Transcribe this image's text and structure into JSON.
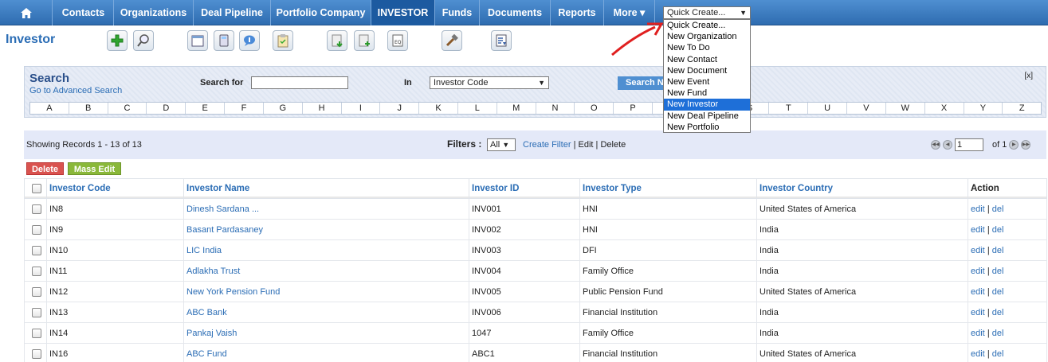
{
  "nav": {
    "home_icon": "home-icon",
    "items": [
      "Contacts",
      "Organizations",
      "Deal Pipeline",
      "Portfolio Company",
      "INVESTOR",
      "Funds",
      "Documents",
      "Reports",
      "More"
    ],
    "active": "INVESTOR",
    "more_arrow": "▾"
  },
  "quick_create": {
    "selected": "Quick Create...",
    "options": [
      "Quick Create...",
      "New Organization",
      "New To Do",
      "New Contact",
      "New Document",
      "New Event",
      "New Fund",
      "New Investor",
      "New Deal Pipeline",
      "New Portfolio"
    ],
    "highlighted": "New Investor"
  },
  "page_title": "Investor",
  "toolbar_icons": [
    "add-icon",
    "search-icon",
    "calendar-icon",
    "calculator-icon",
    "chat-icon",
    "clipboard-icon",
    "import-icon",
    "export-icon",
    "find-duplicates-icon",
    "settings-tools-icon",
    "report-icon"
  ],
  "search": {
    "title": "Search",
    "advanced_link": "Go to Advanced Search",
    "for_label": "Search for",
    "input_value": "",
    "in_label": "In",
    "in_value": "Investor Code",
    "button_label": "Search N",
    "close_label": "[x]",
    "alphabet": [
      "A",
      "B",
      "C",
      "D",
      "E",
      "F",
      "G",
      "H",
      "I",
      "J",
      "K",
      "L",
      "M",
      "N",
      "O",
      "P",
      "Q",
      "R",
      "S",
      "T",
      "U",
      "V",
      "W",
      "X",
      "Y",
      "Z"
    ]
  },
  "records": {
    "showing": "Showing Records 1 - 13 of 13",
    "filters_label": "Filters :",
    "filter_value": "All",
    "create_filter": "Create Filter",
    "sep": "|",
    "edit": "Edit",
    "delete": "Delete",
    "page_value": "1",
    "of_label": "of 1"
  },
  "actions": {
    "delete_label": "Delete",
    "mass_edit_label": "Mass Edit"
  },
  "table": {
    "columns": [
      "Investor Code",
      "Investor Name",
      "Investor ID",
      "Investor Type",
      "Investor Country",
      "Action"
    ],
    "rows": [
      {
        "code": "IN8",
        "name": "Dinesh Sardana ...",
        "id": "INV001",
        "type": "HNI",
        "country": "United States of America"
      },
      {
        "code": "IN9",
        "name": "Basant Pardasaney",
        "id": "INV002",
        "type": "HNI",
        "country": "India"
      },
      {
        "code": "IN10",
        "name": "LIC India",
        "id": "INV003",
        "type": "DFI",
        "country": "India"
      },
      {
        "code": "IN11",
        "name": "Adlakha Trust",
        "id": "INV004",
        "type": "Family Office",
        "country": "India"
      },
      {
        "code": "IN12",
        "name": "New York Pension Fund",
        "id": "INV005",
        "type": "Public Pension Fund",
        "country": "United States of America"
      },
      {
        "code": "IN13",
        "name": "ABC Bank",
        "id": "INV006",
        "type": "Financial Institution",
        "country": "India"
      },
      {
        "code": "IN14",
        "name": "Pankaj Vaish",
        "id": "1047",
        "type": "Family Office",
        "country": "India"
      },
      {
        "code": "IN16",
        "name": "ABC Fund",
        "id": "ABC1",
        "type": "Financial Institution",
        "country": "United States of America"
      }
    ],
    "action_edit": "edit",
    "action_sep": "|",
    "action_del": "del"
  },
  "colors": {
    "nav_bg": "#3f7fc4",
    "nav_active": "#1c5aa0",
    "link": "#2b6db5",
    "delete_btn": "#d9534f",
    "mass_edit_btn": "#8ab83a",
    "annotation_arrow": "#e02020"
  }
}
